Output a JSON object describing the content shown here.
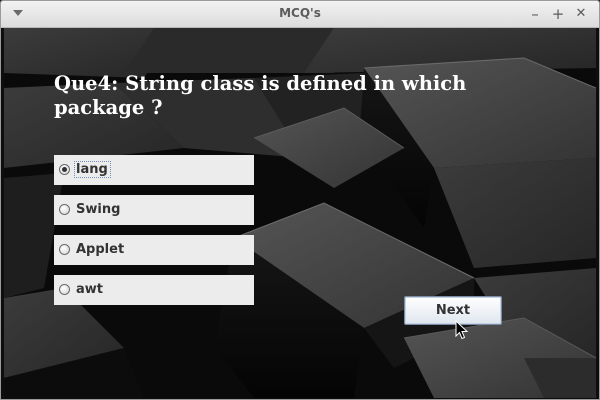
{
  "window": {
    "title": "MCQ's",
    "controls": {
      "minimize": "–",
      "maximize": "+",
      "close": "✕"
    }
  },
  "quiz": {
    "question": "Que4: String class is defined in which package ?",
    "options": [
      {
        "label": "lang",
        "selected": true
      },
      {
        "label": "Swing",
        "selected": false
      },
      {
        "label": "Applet",
        "selected": false
      },
      {
        "label": "awt",
        "selected": false
      }
    ],
    "next_label": "Next"
  },
  "icons": {
    "window_menu": "chevron-down-icon",
    "minimize": "minimize-icon",
    "maximize": "maximize-icon",
    "close": "close-icon",
    "cursor": "mouse-pointer-icon"
  },
  "colors": {
    "background": "#0b0b0b",
    "question_text": "#ffffff",
    "option_bg": "#ececec",
    "titlebar": "#e6e6e6"
  }
}
